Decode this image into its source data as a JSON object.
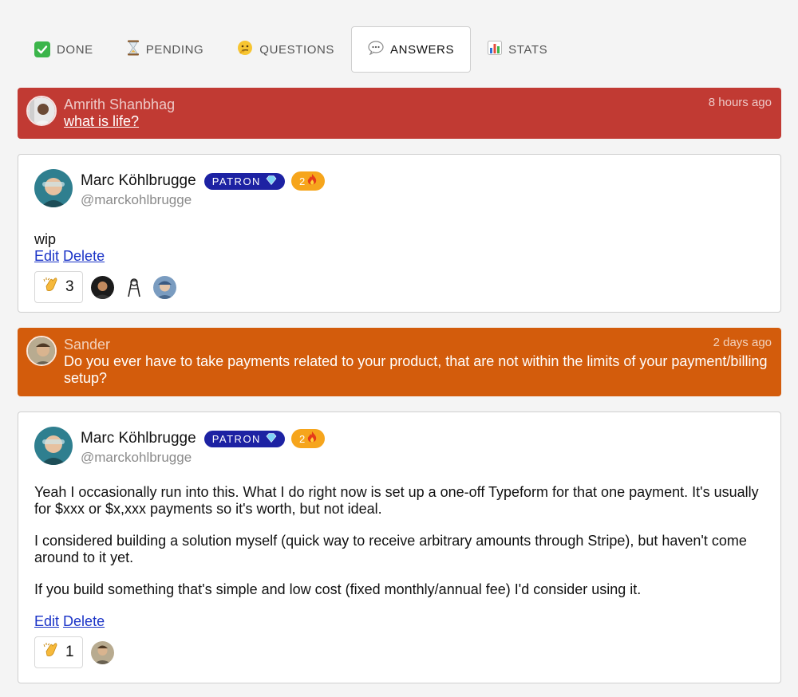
{
  "tabs": [
    {
      "label": "DONE",
      "icon": "check-mark-icon",
      "active": false
    },
    {
      "label": "PENDING",
      "icon": "hourglass-icon",
      "active": false
    },
    {
      "label": "QUESTIONS",
      "icon": "thinking-face-icon",
      "active": false
    },
    {
      "label": "ANSWERS",
      "icon": "speech-bubble-icon",
      "active": true
    },
    {
      "label": "STATS",
      "icon": "bar-chart-icon",
      "active": false
    }
  ],
  "threads": [
    {
      "question": {
        "author": "Amrith Shanbhag",
        "time": "8 hours ago",
        "text": "what is life?",
        "color": "#c13a33"
      },
      "answer": {
        "author": "Marc Köhlbrugge",
        "handle": "@marckohlbrugge",
        "patron_label": "PATRON",
        "streak": "2",
        "paragraphs": [
          "wip"
        ],
        "edit_label": "Edit",
        "delete_label": "Delete",
        "clap_count": "3",
        "reactor_count": 3
      }
    },
    {
      "question": {
        "author": "Sander",
        "time": "2 days ago",
        "text": "Do you ever have to take payments related to your product, that are not within the limits of your payment/billing setup?",
        "color": "#d35c0c"
      },
      "answer": {
        "author": "Marc Köhlbrugge",
        "handle": "@marckohlbrugge",
        "patron_label": "PATRON",
        "streak": "2",
        "paragraphs": [
          "Yeah I occasionally run into this. What I do right now is set up a one-off Typeform for that one payment. It's usually for $xxx or $x,xxx payments so it's worth, but not ideal.",
          "I considered building a solution myself (quick way to receive arbitrary amounts through Stripe), but haven't come around to it yet.",
          "If you build something that's simple and low cost (fixed monthly/annual fee) I'd consider using it."
        ],
        "edit_label": "Edit",
        "delete_label": "Delete",
        "clap_count": "1",
        "reactor_count": 1
      }
    }
  ]
}
